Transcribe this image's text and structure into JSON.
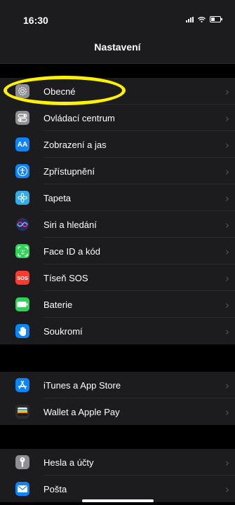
{
  "status_bar": {
    "time": "16:30"
  },
  "nav": {
    "title": "Nastavení"
  },
  "groups": [
    {
      "items": [
        {
          "label": "Obecné",
          "icon": "gear-icon",
          "color": "#8e8e93"
        },
        {
          "label": "Ovládací centrum",
          "icon": "control-center-icon",
          "color": "#8e8e93"
        },
        {
          "label": "Zobrazení a jas",
          "icon": "display-brightness-icon",
          "color": "#0a84ff",
          "glyph": "AA"
        },
        {
          "label": "Zpřístupnění",
          "icon": "accessibility-icon",
          "color": "#0a84ff"
        },
        {
          "label": "Tapeta",
          "icon": "wallpaper-icon",
          "color": "#32ade6"
        },
        {
          "label": "Siri a hledání",
          "icon": "siri-icon",
          "color": "#1c1c1e"
        },
        {
          "label": "Face ID a kód",
          "icon": "face-id-icon",
          "color": "#30d158"
        },
        {
          "label": "Tíseň SOS",
          "icon": "sos-icon",
          "color": "#ff3b30",
          "glyph": "SOS"
        },
        {
          "label": "Baterie",
          "icon": "battery-icon",
          "color": "#30d158"
        },
        {
          "label": "Soukromí",
          "icon": "hand-icon",
          "color": "#0a84ff"
        }
      ]
    },
    {
      "items": [
        {
          "label": "iTunes a App Store",
          "icon": "app-store-icon",
          "color": "#0a84ff"
        },
        {
          "label": "Wallet a Apple Pay",
          "icon": "wallet-icon",
          "color": "#2c2c2e"
        }
      ]
    },
    {
      "items": [
        {
          "label": "Hesla a účty",
          "icon": "key-icon",
          "color": "#8e8e93"
        },
        {
          "label": "Pošta",
          "icon": "mail-icon",
          "color": "#0a84ff"
        }
      ]
    }
  ],
  "annotation": {
    "color": "#fff200",
    "target": "Obecné"
  }
}
